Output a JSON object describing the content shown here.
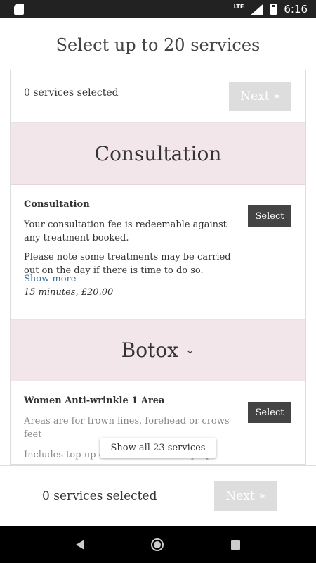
{
  "status_bar": {
    "network": "LTE",
    "time": "6:16"
  },
  "header": {
    "title": "Select up to 20 services"
  },
  "selection": {
    "count_label": "0 services selected",
    "next_label": "Next",
    "next_chevron": "»"
  },
  "sections": [
    {
      "title": "Consultation",
      "services": [
        {
          "name": "Consultation",
          "description": [
            "Your consultation fee is redeemable against any treatment booked.",
            "Please note some treatments may be carried out on the day if there is time to do so."
          ],
          "show_more": "Show more",
          "meta": "15 minutes, £20.00",
          "select_label": "Select"
        }
      ]
    },
    {
      "title": "Botox",
      "toggle_icon": "chevron-down-icon",
      "services": [
        {
          "name": "Women Anti-wrinkle 1 Area",
          "description": [
            "Areas are for frown lines, forehead or crows feet",
            "Includes top-up of 3 weeks later - top-ups"
          ],
          "select_label": "Select"
        }
      ]
    }
  ],
  "show_all_label": "Show all 23 services",
  "bottom_bar": {
    "count_label": "0 services selected",
    "next_label": "Next",
    "next_chevron": "»"
  }
}
